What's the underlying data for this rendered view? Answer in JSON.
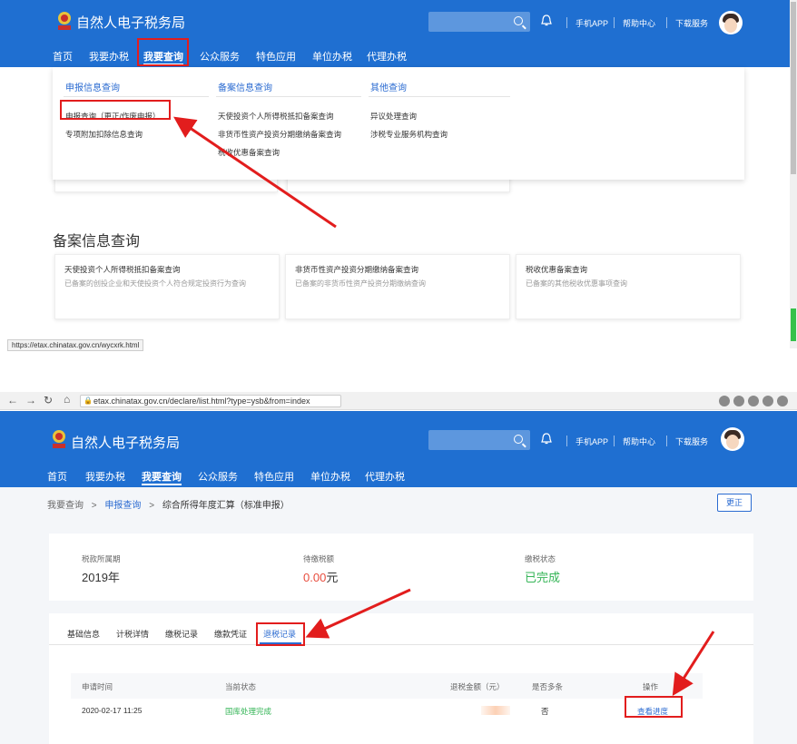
{
  "colors": {
    "brand_blue": "#1f6fd1",
    "annotation_red": "#e21d1d",
    "link_blue": "#2b6bd1",
    "amount_red": "#e84c3d",
    "success_green": "#35b557"
  },
  "icons": [
    "tax-emblem-icon",
    "search-icon",
    "bell-icon",
    "avatar-icon",
    "back-icon",
    "forward-icon",
    "reload-icon",
    "home-icon",
    "lock-icon",
    "extension-icon",
    "chevron-right-icon"
  ],
  "site_name": "自然人电子税务局",
  "header_links": [
    "手机APP",
    "帮助中心",
    "下载服务"
  ],
  "nav": [
    "首页",
    "我要办税",
    "我要查询",
    "公众服务",
    "特色应用",
    "单位办税",
    "代理办税"
  ],
  "menu": {
    "col1": {
      "title": "申报信息查询",
      "items": [
        "申报查询（更正/作废申报）",
        "专项附加扣除信息查询"
      ]
    },
    "col2": {
      "title": "备案信息查询",
      "items": [
        "天使投资个人所得税抵扣备案查询",
        "非货币性资产投资分期缴纳备案查询",
        "税收优惠备案查询"
      ]
    },
    "col3": {
      "title": "其他查询",
      "items": [
        "异议处理查询",
        "涉税专业服务机构查询"
      ]
    }
  },
  "section1": {
    "title": "备案信息查询",
    "cards": [
      {
        "title": "天使投资个人所得税抵扣备案查询",
        "desc": "已备案的创投企业和天使投资个人符合规定投资行为查询"
      },
      {
        "title": "非货币性资产投资分期缴纳备案查询",
        "desc": "已备案的非货币性资产投资分期缴纳查询"
      },
      {
        "title": "税收优惠备案查询",
        "desc": "已备案的其他税收优惠事项查询"
      }
    ]
  },
  "status_url": "https://etax.chinatax.gov.cn/wycxrk.html",
  "browser_url": "etax.chinatax.gov.cn/declare/list.html?type=ysb&from=index",
  "breadcrumb": [
    "我要查询",
    "申报查询",
    "综合所得年度汇算（标准申报）"
  ],
  "update_button": "更正",
  "summary": [
    {
      "label": "税款所属期",
      "value": "2019年"
    },
    {
      "label": "待缴税额",
      "value": "0.00",
      "unit": "元"
    },
    {
      "label": "缴税状态",
      "value": "已完成"
    }
  ],
  "tabs": [
    "基础信息",
    "计税详情",
    "缴税记录",
    "缴款凭证",
    "退税记录"
  ],
  "table": {
    "headers": [
      "申请时间",
      "当前状态",
      "退税金额（元）",
      "是否多条",
      "操作"
    ],
    "row": {
      "time": "2020-02-17 11:25",
      "status": "国库处理完成",
      "amount": "",
      "multiple": "否",
      "action": "查看进度"
    }
  }
}
